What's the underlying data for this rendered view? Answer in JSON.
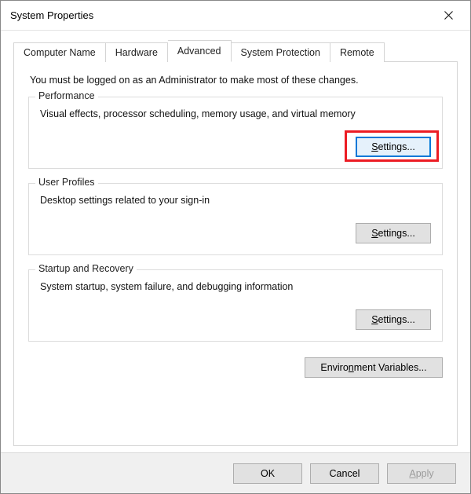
{
  "window": {
    "title": "System Properties"
  },
  "tabs": {
    "computer_name": "Computer Name",
    "hardware": "Hardware",
    "advanced": "Advanced",
    "system_protection": "System Protection",
    "remote": "Remote"
  },
  "advanced_page": {
    "intro": "You must be logged on as an Administrator to make most of these changes.",
    "performance": {
      "legend": "Performance",
      "desc": "Visual effects, processor scheduling, memory usage, and virtual memory",
      "settings_prefix": "S",
      "settings_suffix": "ettings..."
    },
    "user_profiles": {
      "legend": "User Profiles",
      "desc": "Desktop settings related to your sign-in",
      "settings_prefix": "S",
      "settings_suffix": "ettings..."
    },
    "startup_recovery": {
      "legend": "Startup and Recovery",
      "desc": "System startup, system failure, and debugging information",
      "settings_prefix": "S",
      "settings_suffix": "ettings..."
    },
    "env_vars": {
      "prefix": "Enviro",
      "accel": "n",
      "suffix": "ment Variables..."
    }
  },
  "buttons": {
    "ok": "OK",
    "cancel": "Cancel",
    "apply_prefix": "A",
    "apply_suffix": "pply"
  }
}
